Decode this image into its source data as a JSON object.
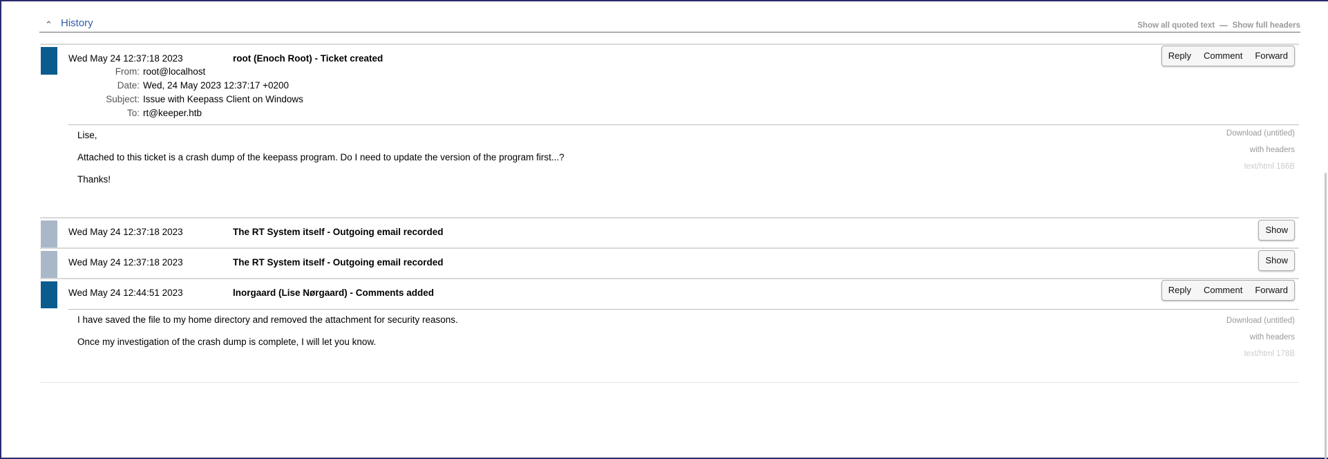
{
  "history": {
    "title": "History",
    "toggle_icon": "chevron-up-icon",
    "links": {
      "show_quoted": "Show all quoted text",
      "separator": "—",
      "show_headers": "Show full headers"
    }
  },
  "colors": {
    "accent": "#0b5c8e",
    "muted": "#a8b8c8",
    "title": "#2f5ba6"
  },
  "transactions": [
    {
      "date": "Wed May 24 12:37:18 2023",
      "description": "root (Enoch Root) - Ticket created",
      "actions": [
        "Reply",
        "Comment",
        "Forward"
      ],
      "headers": [
        {
          "label": "From:",
          "value": "root@localhost"
        },
        {
          "label": "Date:",
          "value": "Wed, 24 May 2023 12:37:17 +0200"
        },
        {
          "label": "Subject:",
          "value": "Issue with Keepass Client on Windows"
        },
        {
          "label": "To:",
          "value": "rt@keeper.htb"
        }
      ],
      "body": [
        "Lise,",
        "Attached to this ticket is a crash dump of the keepass program. Do I need to update the version of the program first...?",
        "Thanks!"
      ],
      "attachment": {
        "download": "Download (untitled)",
        "headers": "with headers",
        "meta": "text/html 166B"
      }
    },
    {
      "date": "Wed May 24 12:37:18 2023",
      "description": "The RT System itself - Outgoing email recorded",
      "action": "Show"
    },
    {
      "date": "Wed May 24 12:37:18 2023",
      "description": "The RT System itself - Outgoing email recorded",
      "action": "Show"
    },
    {
      "date": "Wed May 24 12:44:51 2023",
      "description": "lnorgaard (Lise Nørgaard) - Comments added",
      "actions": [
        "Reply",
        "Comment",
        "Forward"
      ],
      "body": [
        "I have saved the file to my home directory and removed the attachment for security reasons.",
        "Once my investigation of the crash dump is complete, I will let you know."
      ],
      "attachment": {
        "download": "Download (untitled)",
        "headers": "with headers",
        "meta": "text/html 178B"
      }
    }
  ]
}
